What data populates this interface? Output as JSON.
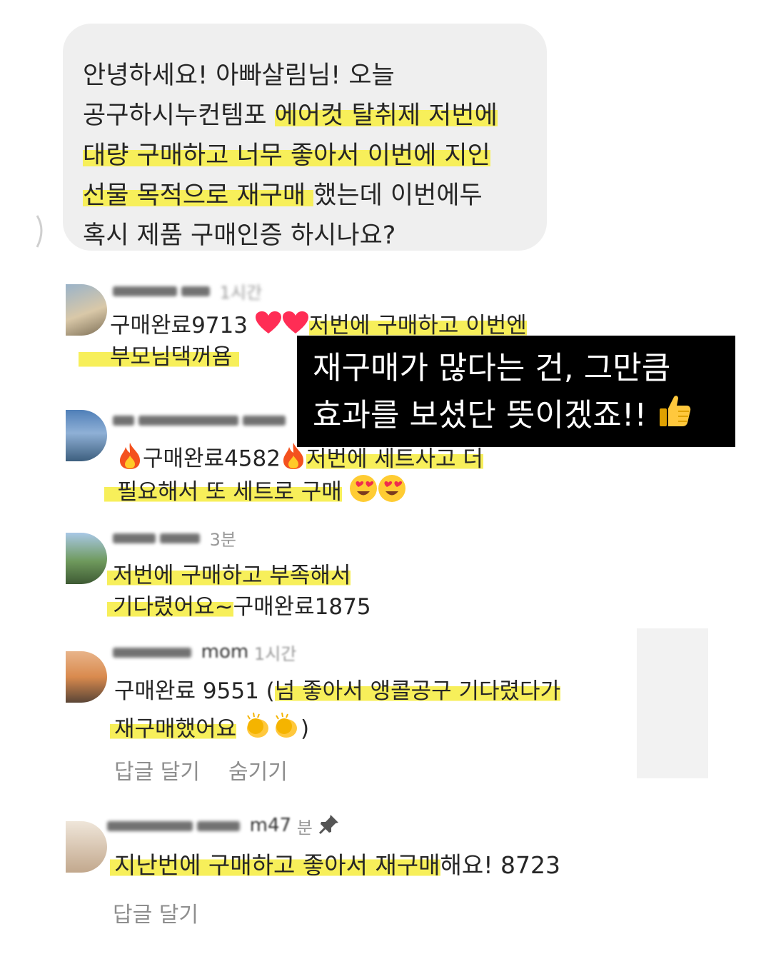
{
  "dm_bubble": {
    "lines": [
      {
        "plain": "안녕하세요! 아빠살림님! 오늘",
        "hl": ""
      },
      {
        "plain": "공구하시누컨템포 ",
        "hl": "에어컷 탈취제 저번에"
      },
      {
        "plain": "",
        "hl": "대량 구매하고 너무 좋아서 이번에 지인"
      },
      {
        "plain_after": "했는데 이번에두",
        "hl": "선물 목적으로 재구매 "
      },
      {
        "plain": "혹시 제품 구매인증 하시나요?",
        "hl": ""
      }
    ]
  },
  "comments": [
    {
      "time": "1시간",
      "text_line1_plain": "구매완료9713",
      "text_line1_hl": "저번에 구매하고 이번엔",
      "text_line2_hl": "부모님댁꺼욤"
    },
    {
      "time": "",
      "text_line1_plain": "구매완료4582",
      "text_line1_hl": "저번에 세트사고 더",
      "text_line2_hl": "필요해서 또 세트로 구매"
    },
    {
      "time": "3분",
      "text_line1_hl": "저번에 구매하고 부족해서",
      "text_line2_hl": "기다렸어요~",
      "text_line2_plain": "구매완료1875"
    },
    {
      "username": "mom",
      "time": "1시간",
      "text_line1_plain": "구매완료 9551 (",
      "text_line1_hl": "넘 좋아서 앵콜공구 기다렸다가",
      "text_line2_hl": "재구매했어요",
      "text_line2_close": ")",
      "reply": "답글 달기",
      "hide": "숨기기"
    },
    {
      "username": "m47",
      "time": "분",
      "text_hl": "지난번에 구매하고 좋아서 재구매",
      "text_plain": "해요! 8723",
      "reply": "답글 달기"
    }
  ],
  "caption": {
    "line1": "재구매가 많다는 건, 그만큼",
    "line2": "효과를 보셨단 뜻이겠죠!!"
  },
  "icons": {
    "heart": "red-heart-icon",
    "fire": "fire-icon",
    "heart_eyes": "heart-eyes-emoji-icon",
    "clap": "clapping-hands-icon",
    "thumbs_up": "thumbs-up-icon",
    "pin": "pin-icon"
  },
  "colors": {
    "highlight": "#f7ef5a",
    "bubble": "#efefef",
    "caption_bg": "#000000",
    "muted": "#8e8e8e"
  }
}
